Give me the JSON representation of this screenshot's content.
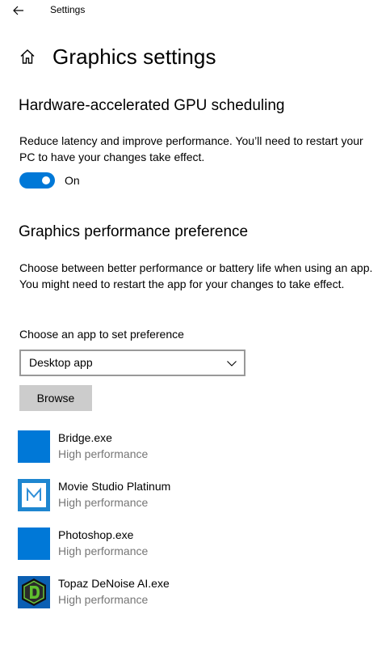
{
  "window": {
    "title": "Settings"
  },
  "page": {
    "title": "Graphics settings"
  },
  "gpu_scheduling": {
    "title": "Hardware-accelerated GPU scheduling",
    "description": "Reduce latency and improve performance. You’ll need to restart your PC to have your changes take effect.",
    "toggle_state": "On",
    "toggle_on": true,
    "accent_color": "#0078d7"
  },
  "performance_pref": {
    "title": "Graphics performance preference",
    "description": "Choose between better performance or battery life when using an app. You might need to restart the app for your changes to take effect.",
    "choose_label": "Choose an app to set preference",
    "dropdown_value": "Desktop app",
    "browse_label": "Browse"
  },
  "apps": [
    {
      "name": "Bridge.exe",
      "preference": "High performance",
      "icon": "blank-app-icon"
    },
    {
      "name": "Movie Studio Platinum",
      "preference": "High performance",
      "icon": "movie-studio-icon"
    },
    {
      "name": "Photoshop.exe",
      "preference": "High performance",
      "icon": "blank-app-icon"
    },
    {
      "name": "Topaz DeNoise AI.exe",
      "preference": "High performance",
      "icon": "topaz-denoise-icon"
    }
  ],
  "icons": {
    "back": "back-arrow-icon",
    "home": "home-icon",
    "dropdown": "chevron-down-icon"
  },
  "colors": {
    "accent": "#0078d7",
    "secondary_text": "#767676",
    "button_bg": "#cccccc",
    "dropdown_border": "#999999"
  }
}
